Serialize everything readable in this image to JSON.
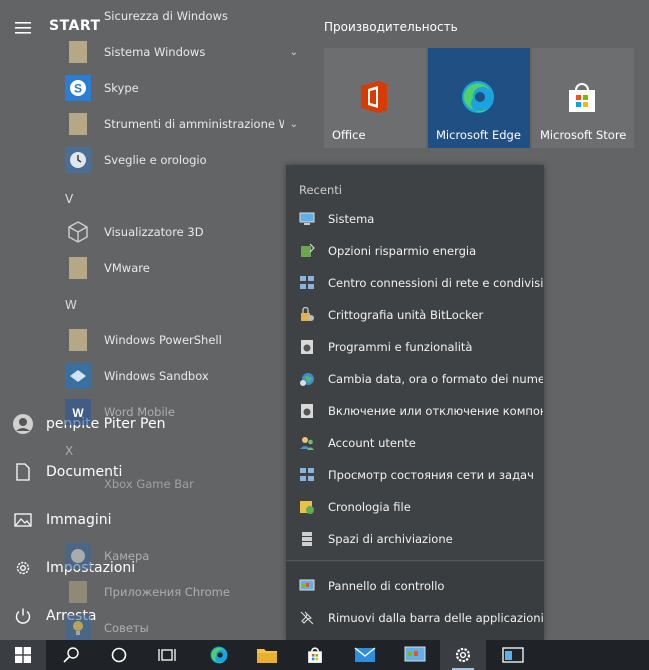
{
  "start": {
    "title": "START"
  },
  "rail": {
    "user": "penpite Piter Pen",
    "documents": "Documenti",
    "pictures": "Immagini",
    "settings": "Impostazioni",
    "power": "Arresta"
  },
  "apps": {
    "items": [
      {
        "label": "Sicurezza di Windows",
        "icon": "shield-icon"
      },
      {
        "label": "Sistema Windows",
        "icon": "folder-icon",
        "expandable": true
      },
      {
        "label": "Skype",
        "icon": "skype-icon"
      },
      {
        "label": "Strumenti di amministrazione Wi...",
        "icon": "folder-icon",
        "expandable": true
      },
      {
        "label": "Sveglie e orologio",
        "icon": "clock-icon"
      },
      {
        "label": "Visualizzatore 3D",
        "icon": "cube-icon"
      },
      {
        "label": "VMware",
        "icon": "folder-icon"
      },
      {
        "label": "Windows PowerShell",
        "icon": "folder-icon"
      },
      {
        "label": "Windows Sandbox",
        "icon": "sandbox-icon"
      },
      {
        "label": "Word Mobile",
        "icon": "word-icon"
      },
      {
        "label": "Xbox Game Bar",
        "icon": "xbox-icon"
      },
      {
        "label": "Камера",
        "icon": "camera-icon"
      },
      {
        "label": "Приложения Chrome",
        "icon": "folder-icon"
      },
      {
        "label": "Советы",
        "icon": "tips-icon"
      }
    ],
    "letters": [
      "V",
      "W",
      "X"
    ]
  },
  "tiles": {
    "group_title": "Производительность",
    "office": "Office",
    "edge": "Microsoft Edge",
    "store": "Microsoft Store"
  },
  "menu": {
    "header": "Recenti",
    "items": [
      {
        "label": "Sistema",
        "icon": "monitor-icon"
      },
      {
        "label": "Opzioni risparmio energia",
        "icon": "power-options-icon"
      },
      {
        "label": "Centro connessioni di rete e condivisio...",
        "icon": "network-icon"
      },
      {
        "label": "Crittografia unità BitLocker",
        "icon": "bitlocker-icon"
      },
      {
        "label": "Programmi e funzionalità",
        "icon": "programs-icon"
      },
      {
        "label": "Cambia data, ora o formato dei numeri",
        "icon": "region-icon"
      },
      {
        "label": "Включение или отключение компон...",
        "icon": "features-icon"
      },
      {
        "label": "Account utente",
        "icon": "users-icon"
      },
      {
        "label": "Просмотр состояния сети и задач",
        "icon": "network-icon"
      },
      {
        "label": "Cronologia file",
        "icon": "file-history-icon"
      },
      {
        "label": "Spazi di archiviazione",
        "icon": "storage-icon"
      }
    ],
    "control_panel": "Pannello di controllo",
    "unpin": "Rimuovi dalla barra delle applicazioni"
  },
  "colors": {
    "edge_tile": "#1f4f83",
    "office_red": "#d83b01",
    "taskbar": "#1f2327"
  }
}
